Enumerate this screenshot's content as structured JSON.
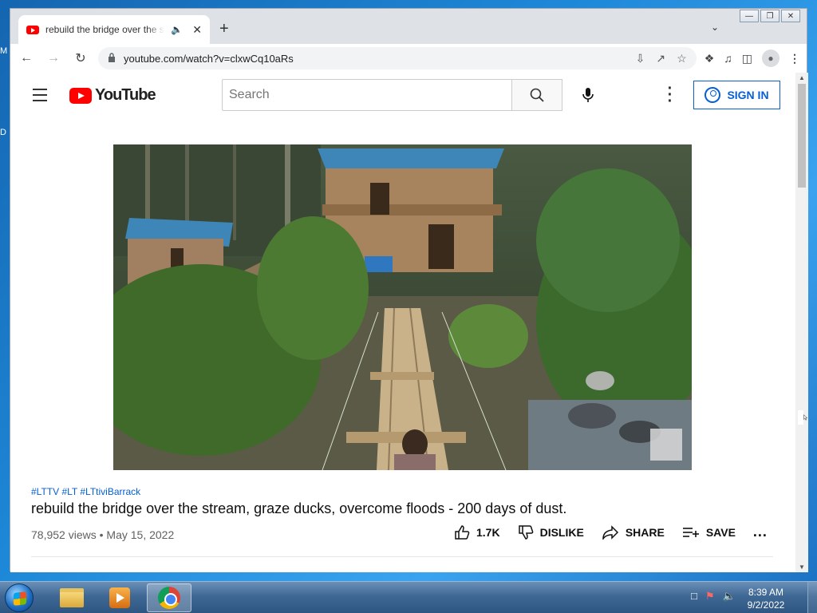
{
  "desktop": {
    "edge_labels": [
      "M",
      "D"
    ]
  },
  "window_controls": [
    "minimize",
    "restore",
    "close"
  ],
  "tab": {
    "title": "rebuild the bridge over the s"
  },
  "address_bar": {
    "url": "youtube.com/watch?v=clxwCq10aRs"
  },
  "youtube": {
    "logo_text": "YouTube",
    "search_placeholder": "Search",
    "sign_in_label": "SIGN IN"
  },
  "video": {
    "hashtags": "#LTTV #LT #LTtiviBarrack",
    "title": "rebuild the bridge over the stream, graze ducks, overcome floods - 200 days of dust.",
    "views": "78,952 views",
    "date": "May 15, 2022",
    "likes": "1.7K",
    "dislike_label": "DISLIKE",
    "share_label": "SHARE",
    "save_label": "SAVE",
    "more_label": "..."
  },
  "taskbar": {
    "time": "8:39 AM",
    "date": "9/2/2022"
  },
  "colors": {
    "accent": "#065fd4",
    "youtube_red": "#ff0000"
  }
}
